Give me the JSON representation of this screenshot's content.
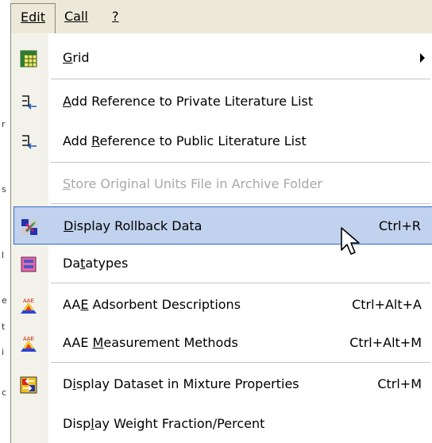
{
  "menubar": {
    "items": [
      {
        "label": "Edit",
        "mnemonic_index": 0
      },
      {
        "label": "Call",
        "mnemonic_index": 0
      },
      {
        "label": "?",
        "mnemonic_index": 0
      }
    ]
  },
  "menu": {
    "items": [
      {
        "id": "grid",
        "label_pre": "",
        "label_u": "G",
        "label_post": "rid",
        "shortcut": "",
        "icon": "grid-icon",
        "submenu": true,
        "disabled": false
      },
      {
        "id": "add-ref-private",
        "label_pre": "",
        "label_u": "A",
        "label_post": "dd Reference to Private Literature List",
        "shortcut": "",
        "icon": "add-reference-icon",
        "disabled": false
      },
      {
        "id": "add-ref-public",
        "label_pre": "Add ",
        "label_u": "R",
        "label_post": "eference to Public Literature List",
        "shortcut": "",
        "icon": "add-reference-icon",
        "disabled": false
      },
      {
        "id": "store-units",
        "label_pre": "",
        "label_u": "S",
        "label_post": "tore Original Units File in Archive Folder",
        "shortcut": "",
        "icon": "",
        "disabled": true
      },
      {
        "id": "display-rollback",
        "label_pre": "",
        "label_u": "D",
        "label_post": "isplay Rollback Data",
        "shortcut": "Ctrl+R",
        "icon": "rollback-data-icon",
        "disabled": false,
        "highlighted": true
      },
      {
        "id": "datatypes",
        "label_pre": "Da",
        "label_u": "t",
        "label_post": "atypes",
        "shortcut": "",
        "icon": "datatypes-icon",
        "disabled": false
      },
      {
        "id": "aae-adsorbent",
        "label_pre": "AA",
        "label_u": "E",
        "label_post": " Adsorbent Descriptions",
        "shortcut": "Ctrl+Alt+A",
        "icon": "aae-icon",
        "disabled": false
      },
      {
        "id": "aae-measurement",
        "label_pre": "AAE ",
        "label_u": "M",
        "label_post": "easurement Methods",
        "shortcut": "Ctrl+Alt+M",
        "icon": "aae-icon",
        "disabled": false
      },
      {
        "id": "display-dataset-mixture",
        "label_pre": "D",
        "label_u": "i",
        "label_post": "splay Dataset in Mixture Properties",
        "shortcut": "Ctrl+M",
        "icon": "mixture-properties-icon",
        "disabled": false
      },
      {
        "id": "display-weight",
        "label_pre": "Disp",
        "label_u": "l",
        "label_post": "ay Weight Fraction/Percent",
        "shortcut": "",
        "icon": "",
        "disabled": false
      }
    ]
  }
}
